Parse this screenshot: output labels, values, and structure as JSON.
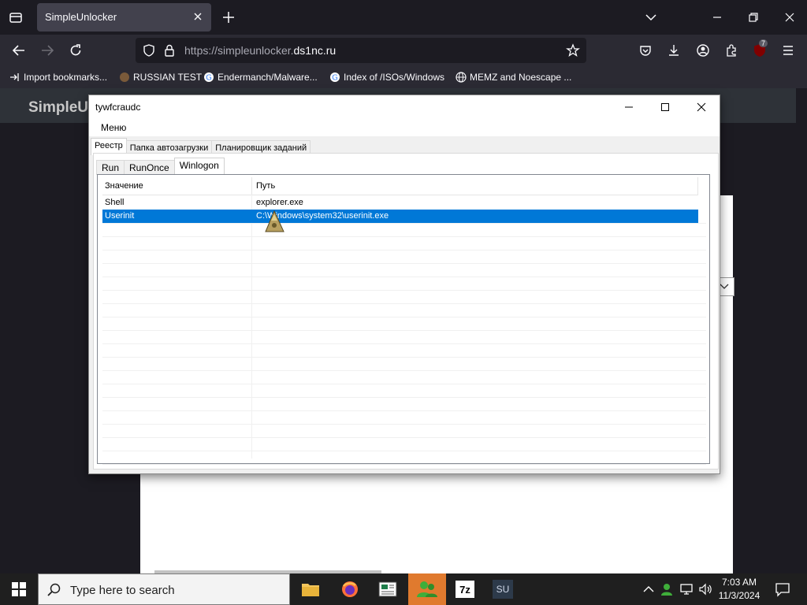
{
  "browser": {
    "tab_title": "SimpleUnlocker",
    "url_prefix": "https://simpleunlocker.",
    "url_domain": "ds1nc.ru",
    "extension_badge": "7",
    "bookmarks": [
      {
        "label": "Import bookmarks...",
        "icon": "import-icon"
      },
      {
        "label": "RUSSIAN TEST",
        "icon": "site-icon"
      },
      {
        "label": "Endermanch/Malware...",
        "icon": "google-icon"
      },
      {
        "label": "Index of /ISOs/Windows",
        "icon": "google-icon"
      },
      {
        "label": "MEMZ and Noescape ...",
        "icon": "globe-icon"
      }
    ]
  },
  "website": {
    "brand": "SimpleU"
  },
  "app": {
    "window_title": "tywfcraudc",
    "menu": "Меню",
    "main_tabs": [
      "Реестр",
      "Папка автозагрузки",
      "Планировщик заданий"
    ],
    "sub_tabs": [
      "Run",
      "RunOnce",
      "Winlogon"
    ],
    "columns": [
      "Значение",
      "Путь"
    ],
    "rows": [
      {
        "name": "Shell",
        "path": "explorer.exe",
        "selected": false
      },
      {
        "name": "Userinit",
        "path": "C:\\Windows\\system32\\userinit.exe",
        "selected": true
      }
    ]
  },
  "taskbar": {
    "search_placeholder": "Type here to search",
    "time": "7:03 AM",
    "date": "11/3/2024",
    "apps": [
      "file-explorer-icon",
      "firefox-icon",
      "news-icon",
      "users-icon",
      "7zip-icon",
      "simpleunlocker-icon"
    ],
    "app_7zip_label": "7z",
    "app_su_label": "SU"
  },
  "colors": {
    "selection": "#0078d7",
    "browser_bg": "#1c1b22",
    "toolbar": "#2b2a33",
    "active_taskbar_app": "#e07a2e"
  }
}
